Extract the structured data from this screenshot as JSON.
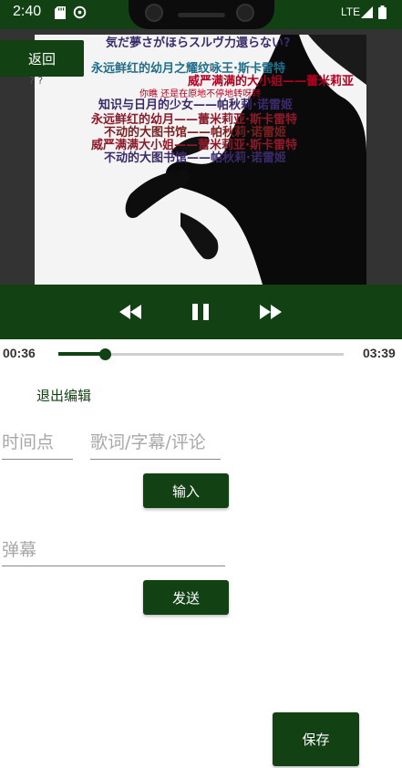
{
  "status_bar": {
    "time": "2:40",
    "network": "LTE"
  },
  "video": {
    "danmaku": [
      {
        "text": "気だ夢さがほらスルヴ力還らない?",
        "color": "#3b2a6a"
      },
      {
        "text": "永远鲜红的幼月之耀纹咏王·斯卡雷特",
        "color": "#1f6f8b"
      },
      {
        "text": "威严满满的大小姐——蕾米莉亚",
        "color": "#b00020"
      },
      {
        "text": "你瞧 还是在原地不停地转呀转",
        "color": "#b00020"
      },
      {
        "text": "知识与日月的少女——帕秋莉·诺雷姬",
        "color": "#3b2a6a"
      },
      {
        "text": "永远鲜红的幼月——蕾米莉亚·斯卡雷特",
        "color": "#8b1a2a"
      },
      {
        "text": "不动的大图书馆——帕秋莉·诺雷姬",
        "color": "#7a1f1f"
      },
      {
        "text": "威严满满大小姐——蕾米莉亚·斯卡雷特",
        "color": "#8b1a2a"
      },
      {
        "text": "不动的大图书馆——帕秋莉·诺雷姬",
        "color": "#3b2a6a"
      }
    ],
    "back_label": "返回",
    "overlay_text": "? ?"
  },
  "player": {
    "current_time": "00:36",
    "total_time": "03:39",
    "progress_percent": 16.4,
    "controls": [
      "rewind-icon",
      "pause-icon",
      "fast-forward-icon"
    ]
  },
  "editor": {
    "exit_label": "退出编辑",
    "time_placeholder": "时间点",
    "lyrics_placeholder": "歌词/字幕/评论",
    "input_button": "输入",
    "danmaku_placeholder": "弹幕",
    "send_button": "发送",
    "save_button": "保存"
  },
  "colors": {
    "primary": "#124214",
    "video_bg": "#333333"
  }
}
